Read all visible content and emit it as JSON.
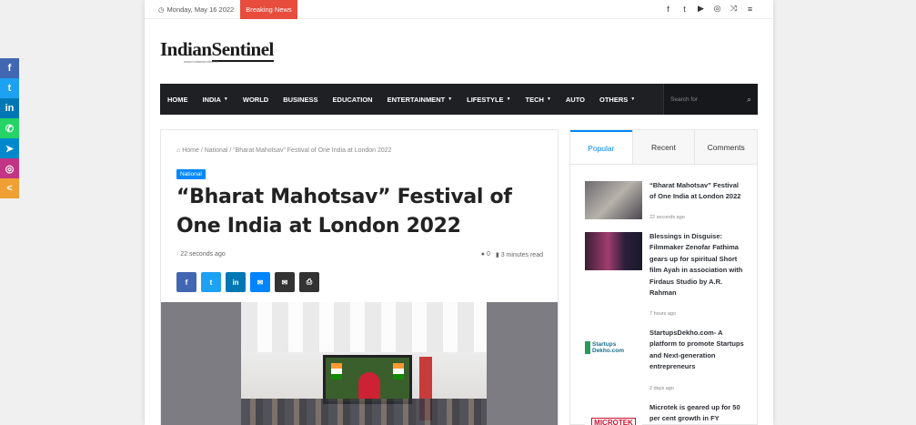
{
  "colors": {
    "accent": "#0088ff",
    "breaking": "#e74c3c",
    "nav_bg": "#1f2024",
    "facebook": "#4267b2",
    "twitter": "#1da1f2",
    "linkedin": "#0077b5",
    "whatsapp": "#25d366",
    "telegram": "#0088cc",
    "instagram": "#c13584",
    "share": "#ef9f33",
    "messenger": "#0084ff",
    "email": "#333333",
    "print": "#333333"
  },
  "float_share": [
    {
      "icon": "facebook-icon",
      "glyph": "f",
      "color": "#4267b2"
    },
    {
      "icon": "twitter-icon",
      "glyph": "t",
      "color": "#1da1f2"
    },
    {
      "icon": "linkedin-icon",
      "glyph": "in",
      "color": "#0077b5"
    },
    {
      "icon": "whatsapp-icon",
      "glyph": "✆",
      "color": "#25d366"
    },
    {
      "icon": "telegram-icon",
      "glyph": "➤",
      "color": "#0088cc"
    },
    {
      "icon": "instagram-icon",
      "glyph": "◎",
      "color": "#c13584"
    },
    {
      "icon": "share-icon",
      "glyph": "<",
      "color": "#ef9f33"
    }
  ],
  "topbar": {
    "date": "Monday, May 16 2022",
    "breaking_label": "Breaking News",
    "social_icons": [
      "facebook-icon",
      "twitter-icon",
      "youtube-icon",
      "instagram-icon",
      "random-icon",
      "menu-icon"
    ]
  },
  "logo": {
    "part1": "Indian",
    "part2": "Sentinel",
    "tagline": "www.indiansentinel.in"
  },
  "nav": {
    "items": [
      {
        "label": "HOME",
        "dropdown": false
      },
      {
        "label": "INDIA",
        "dropdown": true
      },
      {
        "label": "WORLD",
        "dropdown": false
      },
      {
        "label": "BUSINESS",
        "dropdown": false
      },
      {
        "label": "EDUCATION",
        "dropdown": false
      },
      {
        "label": "ENTERTAINMENT",
        "dropdown": true
      },
      {
        "label": "LIFESTYLE",
        "dropdown": true
      },
      {
        "label": "TECH",
        "dropdown": true
      },
      {
        "label": "AUTO",
        "dropdown": false
      },
      {
        "label": "OTHERS",
        "dropdown": true
      }
    ],
    "search_placeholder": "Search for"
  },
  "article": {
    "breadcrumb": {
      "home": "Home",
      "sep": " / ",
      "section": "National",
      "current": "“Bharat Mahotsav” Festival of One India at London 2022"
    },
    "category": "National",
    "title": "“Bharat Mahotsav” Festival of One India at London 2022",
    "time": "22 seconds ago",
    "comments": "0",
    "read_time": "3 minutes read",
    "share_buttons": [
      {
        "icon": "facebook-icon",
        "glyph": "f",
        "color": "#4267b2"
      },
      {
        "icon": "twitter-icon",
        "glyph": "t",
        "color": "#1da1f2"
      },
      {
        "icon": "linkedin-icon",
        "glyph": "in",
        "color": "#0077b5"
      },
      {
        "icon": "messenger-icon",
        "glyph": "✉",
        "color": "#0084ff"
      },
      {
        "icon": "email-icon",
        "glyph": "✉",
        "color": "#333333"
      },
      {
        "icon": "print-icon",
        "glyph": "⎙",
        "color": "#333333"
      }
    ]
  },
  "sidebar": {
    "tabs": [
      "Popular",
      "Recent",
      "Comments"
    ],
    "posts": [
      {
        "title": "“Bharat Mahotsav” Festival of One India at London 2022",
        "time": "22 seconds ago"
      },
      {
        "title": "Blessings in Disguise: Filmmaker Zenofar Fathima gears up for spiritual Short film Ayah in association with Firdaus Studio by A.R. Rahman",
        "time": "7 hours ago"
      },
      {
        "title": "StartupsDekho.com- A platform to promote Startups and Next-generation entrepreneurs",
        "time": "2 days ago",
        "thumb_text": "Startups Dekho.com"
      },
      {
        "title": "Microtek is geared up for 50 per cent growth in FY",
        "time": "",
        "thumb_text": "MICROTEK"
      }
    ]
  }
}
